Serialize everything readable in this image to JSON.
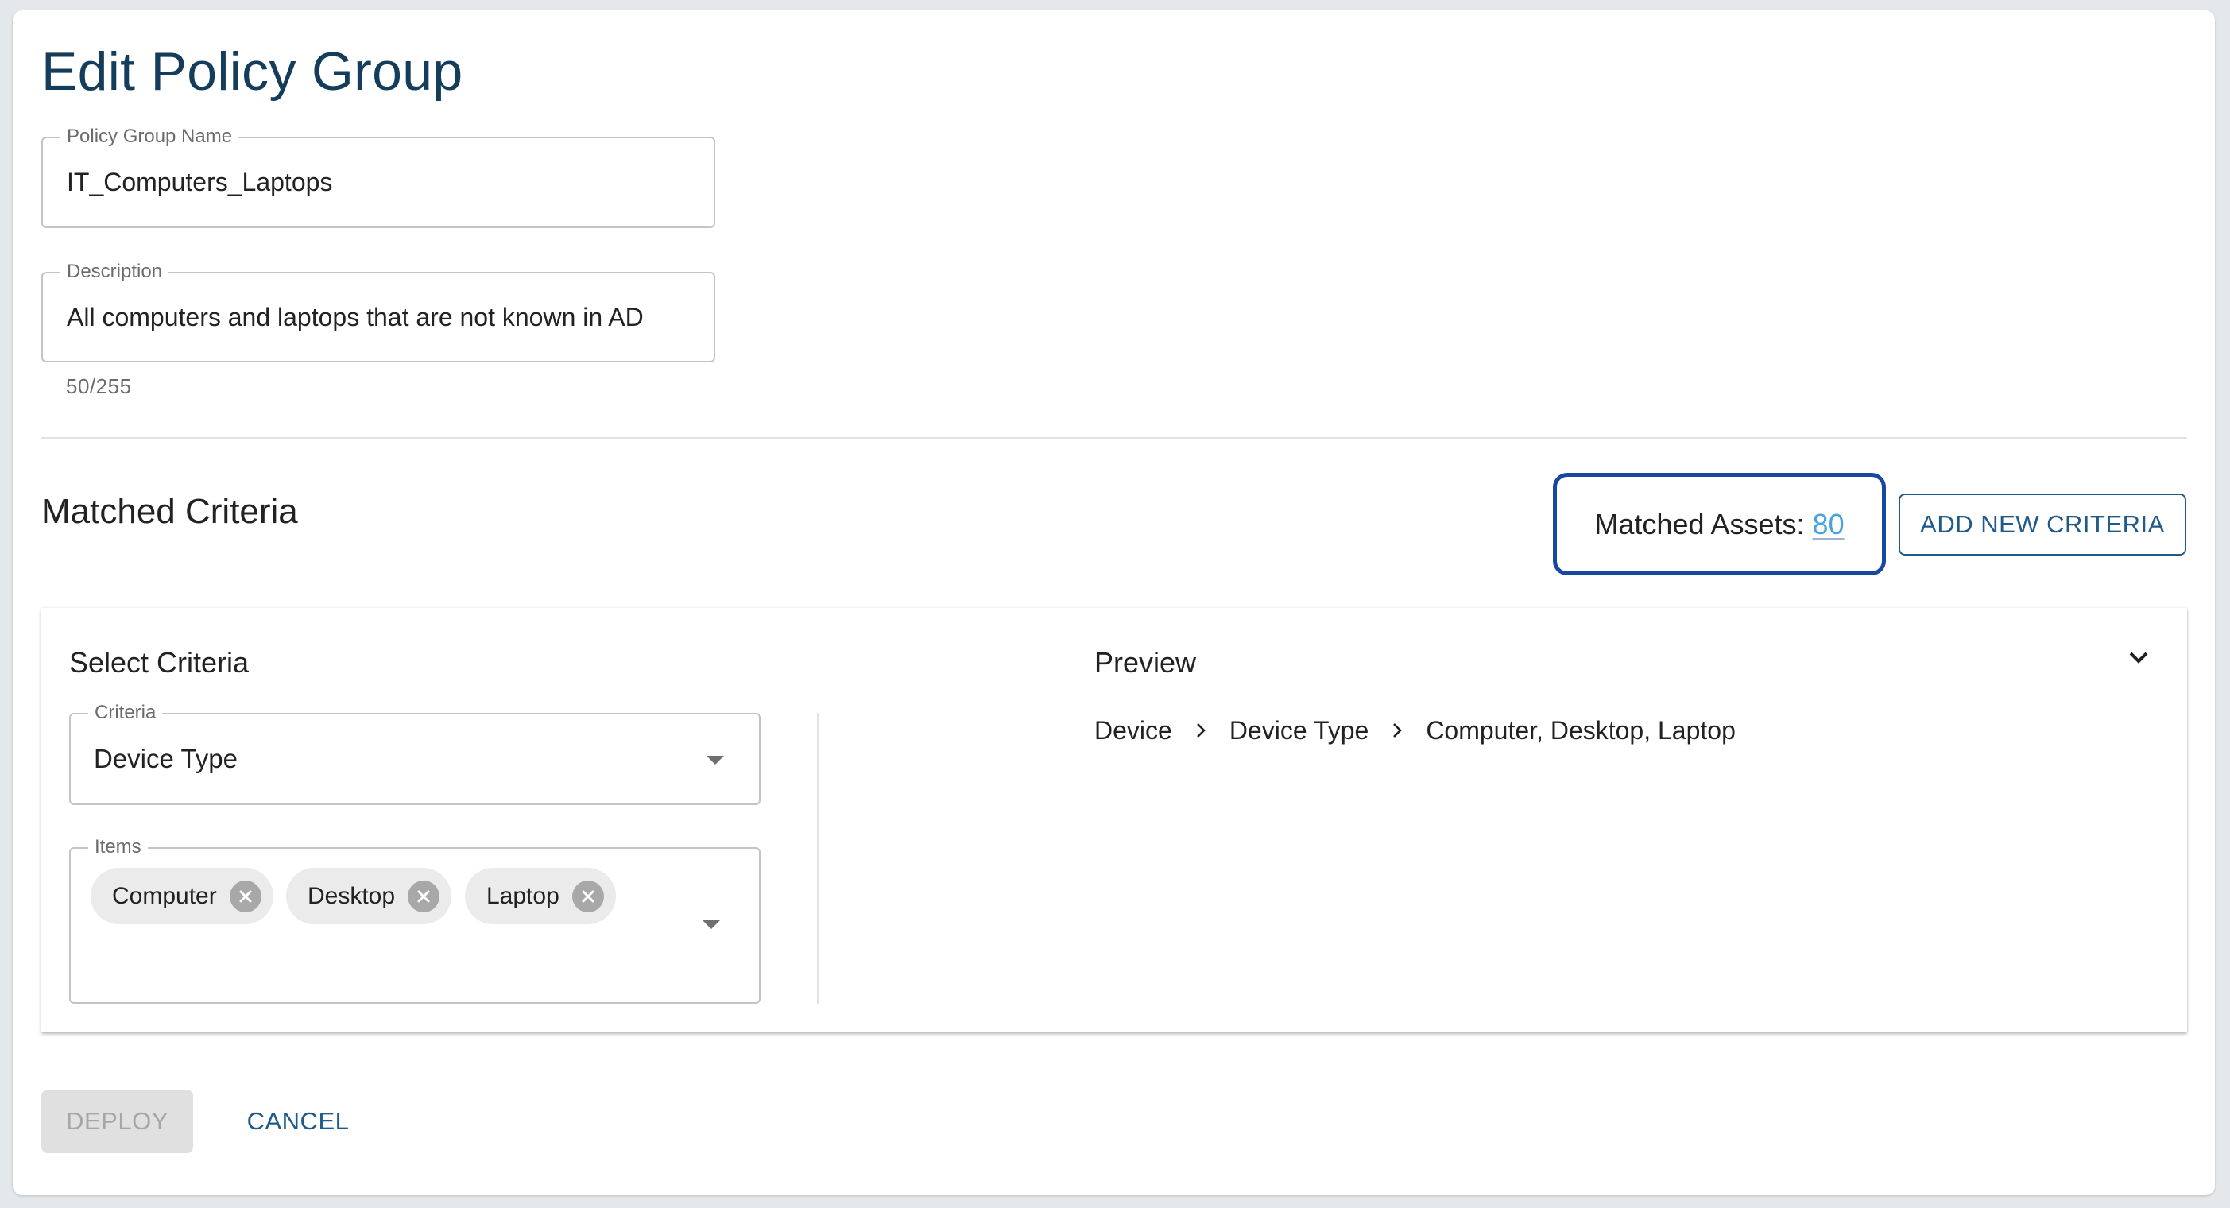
{
  "page": {
    "title": "Edit Policy Group"
  },
  "form": {
    "name_field": {
      "label": "Policy Group Name",
      "value": "IT_Computers_Laptops"
    },
    "description_field": {
      "label": "Description",
      "value": "All computers and laptops that are not known in AD",
      "char_count": "50/255"
    }
  },
  "matched_criteria": {
    "title": "Matched Criteria",
    "matched_assets_label": "Matched Assets:",
    "matched_assets_count": "80",
    "add_button_label": "ADD NEW CRITERIA",
    "colors": {
      "highlight_border": "#1747a1",
      "link": "#4aa3df",
      "primary": "#1f5a88"
    }
  },
  "criteria_card": {
    "select_heading": "Select Criteria",
    "criteria_select": {
      "label": "Criteria",
      "value": "Device Type"
    },
    "items_select": {
      "label": "Items",
      "chips": [
        {
          "label": "Computer"
        },
        {
          "label": "Desktop"
        },
        {
          "label": "Laptop"
        }
      ]
    },
    "preview": {
      "heading": "Preview",
      "path": [
        "Device",
        "Device Type",
        "Computer, Desktop, Laptop"
      ],
      "separator_icon": "chevron-right-icon",
      "toggle_icon": "chevron-down-icon"
    }
  },
  "actions": {
    "deploy_label": "DEPLOY",
    "deploy_disabled": true,
    "cancel_label": "CANCEL"
  }
}
